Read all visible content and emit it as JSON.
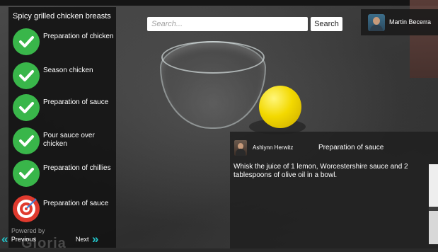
{
  "recipe": {
    "title": "Spicy grilled chicken breasts",
    "steps": [
      {
        "label": "Preparation of chicken",
        "status": "done",
        "icon": "check-icon"
      },
      {
        "label": "Season chicken",
        "status": "done",
        "icon": "check-icon"
      },
      {
        "label": "Preparation of sauce",
        "status": "done",
        "icon": "check-icon"
      },
      {
        "label": "Pour sauce over chicken",
        "status": "done",
        "icon": "check-icon"
      },
      {
        "label": "Preparation of chillies",
        "status": "done",
        "icon": "check-icon"
      },
      {
        "label": "Preparation of sauce",
        "status": "current",
        "icon": "target-icon"
      }
    ],
    "powered_by": "Powered by",
    "watermark": "Gloria"
  },
  "nav": {
    "previous_label": "Previous",
    "next_label": "Next"
  },
  "search": {
    "placeholder": "Search...",
    "button_label": "Search"
  },
  "user": {
    "name": "Martin Becerra"
  },
  "card": {
    "author": "Ashlynn Herwitz",
    "step_title": "Preparation of  sauce",
    "text": "Whisk the juice of 1 lemon, Worcestershire sauce and 2 tablespoons of olive oil in a bowl."
  },
  "colors": {
    "done": "#39b64a",
    "current": "#e03a2e",
    "nav_accent": "#22c3c8"
  }
}
